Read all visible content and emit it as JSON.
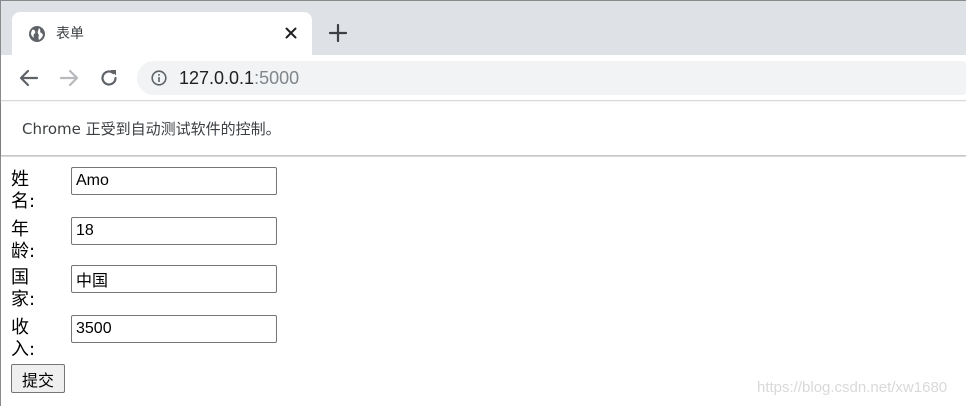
{
  "browser": {
    "tab": {
      "title": "表单",
      "favicon": "globe-icon"
    },
    "new_tab_icon": "plus-icon",
    "url_host": "127.0.0.1",
    "url_port": ":5000",
    "infobar_text": "Chrome 正受到自动测试软件的控制。"
  },
  "form": {
    "fields": [
      {
        "label": "姓名:",
        "value": "Amo"
      },
      {
        "label": "年龄:",
        "value": "18"
      },
      {
        "label": "国家:",
        "value": "中国"
      },
      {
        "label": "收入:",
        "value": "3500"
      }
    ],
    "submit_label": "提交"
  },
  "watermark": "https://blog.csdn.net/xw1680",
  "colors": {
    "tabstrip": "#dee1e6",
    "omnibox": "#f1f3f4",
    "icon": "#5f6368",
    "button": "#efefef"
  }
}
